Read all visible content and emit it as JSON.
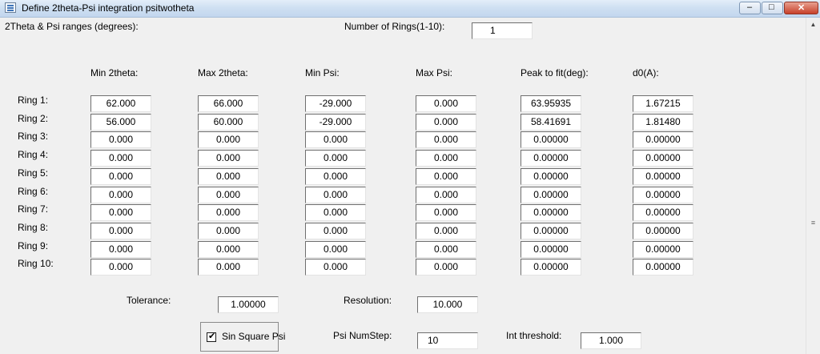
{
  "window": {
    "title": "Define 2theta-Psi integration psitwotheta",
    "minimize_glyph": "–",
    "maximize_glyph": "□",
    "close_glyph": "✕"
  },
  "header": {
    "ranges_label": "2Theta & Psi ranges (degrees):",
    "num_rings_label": "Number of Rings(1-10):",
    "num_rings_value": "1"
  },
  "columns": [
    "Min 2theta:",
    "Max 2theta:",
    "Min Psi:",
    "Max Psi:",
    "Peak to fit(deg):",
    "d0(A):"
  ],
  "rings": [
    {
      "label": "Ring 1:",
      "values": [
        "62.000",
        "66.000",
        "-29.000",
        "0.000",
        "63.95935",
        "1.67215"
      ]
    },
    {
      "label": "Ring 2:",
      "values": [
        "56.000",
        "60.000",
        "-29.000",
        "0.000",
        "58.41691",
        "1.81480"
      ]
    },
    {
      "label": "Ring 3:",
      "values": [
        "0.000",
        "0.000",
        "0.000",
        "0.000",
        "0.00000",
        "0.00000"
      ]
    },
    {
      "label": "Ring 4:",
      "values": [
        "0.000",
        "0.000",
        "0.000",
        "0.000",
        "0.00000",
        "0.00000"
      ]
    },
    {
      "label": "Ring 5:",
      "values": [
        "0.000",
        "0.000",
        "0.000",
        "0.000",
        "0.00000",
        "0.00000"
      ]
    },
    {
      "label": "Ring 6:",
      "values": [
        "0.000",
        "0.000",
        "0.000",
        "0.000",
        "0.00000",
        "0.00000"
      ]
    },
    {
      "label": "Ring 7:",
      "values": [
        "0.000",
        "0.000",
        "0.000",
        "0.000",
        "0.00000",
        "0.00000"
      ]
    },
    {
      "label": "Ring 8:",
      "values": [
        "0.000",
        "0.000",
        "0.000",
        "0.000",
        "0.00000",
        "0.00000"
      ]
    },
    {
      "label": "Ring 9:",
      "values": [
        "0.000",
        "0.000",
        "0.000",
        "0.000",
        "0.00000",
        "0.00000"
      ]
    },
    {
      "label": "Ring 10:",
      "values": [
        "0.000",
        "0.000",
        "0.000",
        "0.000",
        "0.00000",
        "0.00000"
      ]
    }
  ],
  "settings": {
    "tolerance_label": "Tolerance:",
    "tolerance_value": "1.00000",
    "resolution_label": "Resolution:",
    "resolution_value": "10.000",
    "sin_square_psi_label": "Sin Square Psi",
    "sin_square_psi_checked": true,
    "sin_square_psi_mark": "✔",
    "psi_numstep_label": "Psi NumStep:",
    "psi_numstep_value": "10",
    "int_threshold_label": "Int threshold:",
    "int_threshold_value": "1.000"
  },
  "scrollbar": {
    "up_arrow": "▲",
    "grip": "≡"
  }
}
